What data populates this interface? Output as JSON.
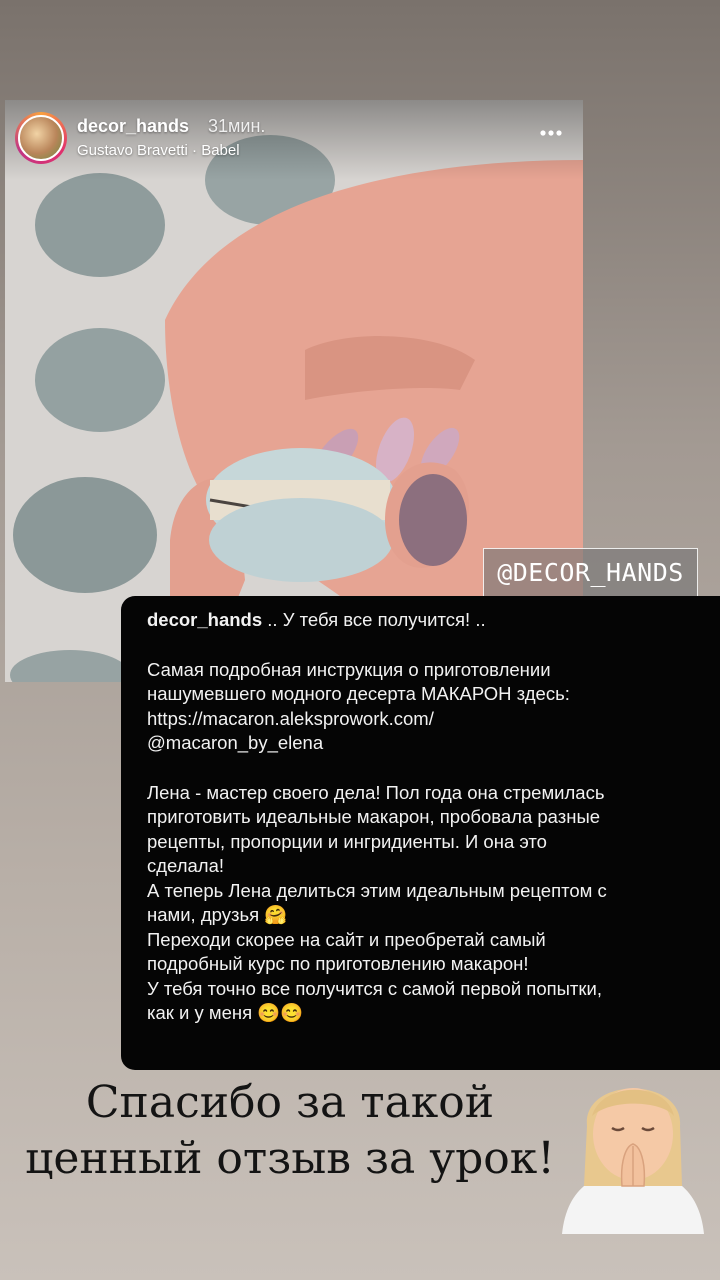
{
  "story": {
    "username": "decor_hands",
    "time": "31мин.",
    "music": "Gustavo Bravetti · Babel",
    "more_icon": "more-horizontal-icon"
  },
  "watermark": "@DECOR_HANDS",
  "caption": {
    "username": "decor_hands",
    "intro": " .. У тебя все получится! ..",
    "para1": "Самая подробная инструкция о приготовлении\nнашумевшего модного десерта МАКАРОН здесь:\nhttps://macaron.aleksprowork.com/\n@macaron_by_elena",
    "para2": "Лена - мастер своего дела! Пол года она стремилась\nприготовить идеальные макарон, пробовала разные\nрецепты, пропорции и ингридиенты. И она это\nсделала!\nА теперь Лена делиться этим идеальным рецептом с\nнами, друзья 🤗\nПереходи скорее на сайт и преобретай самый\nподробный курс по приготовлению макарон!\nУ тебя точно все получится с самой первой попытки,\nкак и у меня 😊😊"
  },
  "overlay_text": "Спасибо за такой\nценный отзыв за урок!",
  "colors": {
    "caption_bg": "#050505",
    "caption_text": "#f2f2f2",
    "overlay_text": "#141414"
  }
}
